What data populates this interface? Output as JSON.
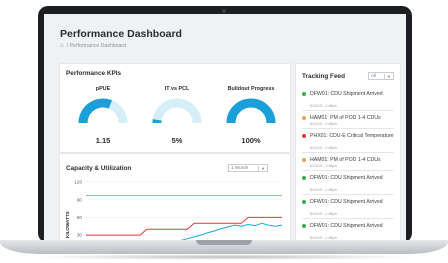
{
  "dashboard": {
    "title": "Performance Dashboard",
    "breadcrumb": "/ Performance Dashboard"
  },
  "kpi": {
    "title": "Performance KPIs",
    "gauges": [
      {
        "label": "pPUE",
        "value": "1.15",
        "fill": 0.62
      },
      {
        "label": "IT vs PCL",
        "value": "5%",
        "fill": 0.05
      },
      {
        "label": "Buildout Progress",
        "value": "100%",
        "fill": 1.0
      }
    ]
  },
  "capacity": {
    "title": "Capacity & Utilization",
    "range_value": "1 Month",
    "chart_data": {
      "type": "line",
      "ylabel": "KILOWATTS",
      "yticks": [
        120,
        90,
        60,
        30
      ],
      "ylim": [
        15,
        130
      ],
      "x": [
        0,
        1,
        2,
        3,
        4,
        5,
        6,
        7,
        8,
        9,
        10,
        11,
        12,
        13,
        14,
        15,
        16,
        17,
        18,
        19,
        20,
        21,
        22,
        23,
        24,
        25,
        26,
        27,
        28,
        29
      ],
      "series": [
        {
          "color": "#f0a24a",
          "values": [
            97,
            97,
            97,
            97,
            97,
            97,
            97,
            97,
            97,
            97,
            97,
            97,
            97,
            97,
            97,
            97,
            97,
            97,
            97,
            97,
            97,
            97,
            97,
            97,
            97,
            97,
            97,
            97,
            97,
            97
          ]
        },
        {
          "color": "#e8343c",
          "values": [
            30,
            30,
            30,
            30,
            30,
            30,
            30,
            30,
            30,
            40,
            40,
            40,
            40,
            40,
            40,
            40,
            50,
            50,
            50,
            50,
            50,
            50,
            50,
            50,
            60,
            60,
            60,
            60,
            60,
            60
          ]
        },
        {
          "color": "#1aa6df",
          "values": [
            17,
            17,
            17,
            17,
            17,
            17,
            17,
            17,
            17,
            17,
            17,
            17,
            18,
            19,
            21,
            24,
            27,
            30,
            34,
            37,
            41,
            44,
            47,
            45,
            48,
            46,
            50,
            47,
            45,
            47
          ]
        }
      ]
    }
  },
  "feed": {
    "title": "Tracking Feed",
    "filter_value": "All",
    "items": [
      {
        "color": "#34b24a",
        "text": "DFW01: CDU Shipment Arrived",
        "time": "8/10/15 - 1:48pm"
      },
      {
        "color": "#f0a24a",
        "text": "HAM01: PM of POD 1-4 CDUs",
        "time": "8/10/15 - 1:48pm"
      },
      {
        "color": "#e8343c",
        "text": "PHX01: CDU-E Critical Temperature",
        "time": "8/10/15 - 1:48pm"
      },
      {
        "color": "#f0a24a",
        "text": "HAM01: PM of POD 1-4 CDUs",
        "time": "8/10/15 - 1:48pm"
      },
      {
        "color": "#34b24a",
        "text": "DFW01: CDU Shipment Arrived",
        "time": "8/10/15 - 1:48pm"
      },
      {
        "color": "#34b24a",
        "text": "DFW01: CDU Shipment Arrived",
        "time": "8/10/15 - 1:48pm"
      },
      {
        "color": "#34b24a",
        "text": "DFW01: CDU Shipment Arrived",
        "time": "8/10/15 - 1:48pm"
      }
    ]
  },
  "colors": {
    "accent": "#1a9fd8",
    "gauge_track": "#d6eef8"
  }
}
